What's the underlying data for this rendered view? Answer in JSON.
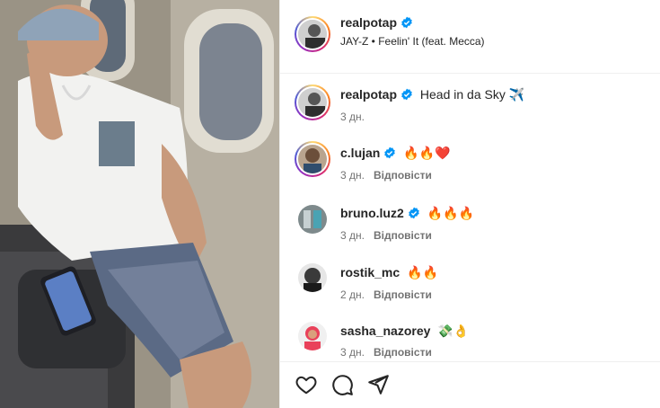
{
  "post": {
    "author": "realpotap",
    "audio": "JAY-Z • Feelin' It (feat. Mecca)"
  },
  "comments": [
    {
      "user": "realpotap",
      "text": "Head in da Sky",
      "emoji": "✈️",
      "time": "3 дн.",
      "reply": ""
    },
    {
      "user": "c.lujan",
      "text": "",
      "emoji": "🔥🔥❤️",
      "time": "3 дн.",
      "reply": "Відповісти"
    },
    {
      "user": "bruno.luz2",
      "text": "",
      "emoji": "🔥🔥🔥",
      "time": "3 дн.",
      "reply": "Відповісти"
    },
    {
      "user": "rostik_mc",
      "text": "",
      "emoji": "🔥🔥",
      "time": "2 дн.",
      "reply": "Відповісти"
    },
    {
      "user": "sasha_nazorey",
      "text": "",
      "emoji": "💸👌",
      "time": "3 дн.",
      "reply": "Відповісти"
    }
  ],
  "icons": {
    "verified": "verified-badge-icon",
    "like": "heart-icon",
    "comment": "comment-bubble-icon",
    "share": "paper-plane-icon"
  },
  "colors": {
    "verified": "#0095f6",
    "muted": "#737373",
    "text": "#262626",
    "divider": "#efefef"
  }
}
